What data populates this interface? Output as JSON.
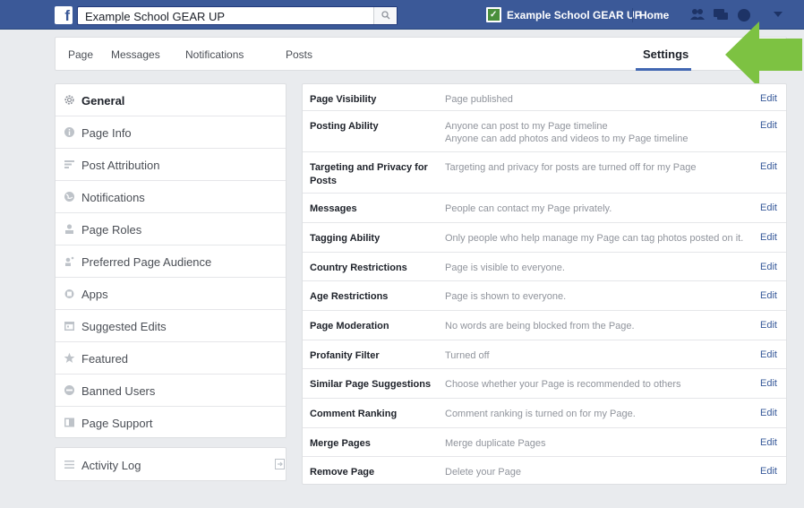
{
  "topbar": {
    "logo": "f",
    "search_value": "Example School GEAR UP",
    "page_name": "Example School GEAR UP",
    "home_label": "Home",
    "icons": [
      "friend-requests-icon",
      "messages-icon",
      "notifications-icon"
    ]
  },
  "subnav": {
    "page": "Page",
    "messages": "Messages",
    "notifications": "Notifications",
    "posts": "Posts",
    "settings": "Settings"
  },
  "leftmenu": {
    "items": [
      {
        "label": "General",
        "icon": "gear-icon"
      },
      {
        "label": "Page Info",
        "icon": "info-icon"
      },
      {
        "label": "Post Attribution",
        "icon": "flag-icon"
      },
      {
        "label": "Notifications",
        "icon": "globe-icon"
      },
      {
        "label": "Page Roles",
        "icon": "person-icon"
      },
      {
        "label": "Preferred Page Audience",
        "icon": "audience-icon"
      },
      {
        "label": "Apps",
        "icon": "apps-icon"
      },
      {
        "label": "Suggested Edits",
        "icon": "calendar-icon"
      },
      {
        "label": "Featured",
        "icon": "star-icon"
      },
      {
        "label": "Banned Users",
        "icon": "ban-icon"
      },
      {
        "label": "Page Support",
        "icon": "support-icon"
      }
    ],
    "activity_log": "Activity Log"
  },
  "settings": {
    "edit_label": "Edit",
    "rows": [
      {
        "label": "Page Visibility",
        "desc": [
          "Page published"
        ]
      },
      {
        "label": "Posting Ability",
        "desc": [
          "Anyone can post to my Page timeline",
          "Anyone can add photos and videos to my Page timeline"
        ]
      },
      {
        "label": "Targeting and Privacy for Posts",
        "desc": [
          "Targeting and privacy for posts are turned off for my Page"
        ]
      },
      {
        "label": "Messages",
        "desc": [
          "People can contact my Page privately."
        ]
      },
      {
        "label": "Tagging Ability",
        "desc": [
          "Only people who help manage my Page can tag photos posted on it."
        ]
      },
      {
        "label": "Country Restrictions",
        "desc": [
          "Page is visible to everyone."
        ]
      },
      {
        "label": "Age Restrictions",
        "desc": [
          "Page is shown to everyone."
        ]
      },
      {
        "label": "Page Moderation",
        "desc": [
          "No words are being blocked from the Page."
        ]
      },
      {
        "label": "Profanity Filter",
        "desc": [
          "Turned off"
        ]
      },
      {
        "label": "Similar Page Suggestions",
        "desc": [
          "Choose whether your Page is recommended to others"
        ]
      },
      {
        "label": "Comment Ranking",
        "desc": [
          "Comment ranking is turned on for my Page."
        ]
      },
      {
        "label": "Merge Pages",
        "desc": [
          "Merge duplicate Pages"
        ]
      },
      {
        "label": "Remove Page",
        "desc": [
          "Delete your Page"
        ]
      }
    ]
  },
  "colors": {
    "brand_blue": "#3b5998",
    "link_blue": "#365899",
    "arrow_green": "#7dc242"
  }
}
